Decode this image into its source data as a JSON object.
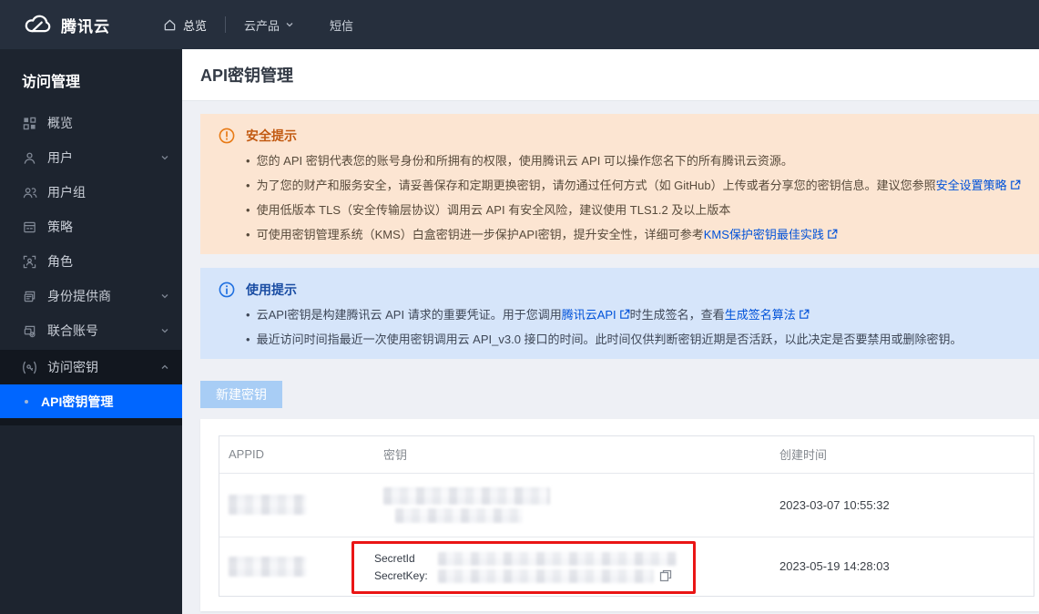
{
  "topbar": {
    "brand": "腾讯云",
    "overview": "总览",
    "cloud_products": "云产品",
    "sms": "短信"
  },
  "sidebar": {
    "title": "访问管理",
    "items": [
      {
        "label": "概览"
      },
      {
        "label": "用户",
        "expandable": true
      },
      {
        "label": "用户组"
      },
      {
        "label": "策略"
      },
      {
        "label": "角色"
      },
      {
        "label": "身份提供商",
        "expandable": true
      },
      {
        "label": "联合账号",
        "expandable": true
      },
      {
        "label": "访问密钥",
        "expandable": true,
        "expanded": true
      }
    ],
    "active_subitem": "API密钥管理"
  },
  "page": {
    "title": "API密钥管理"
  },
  "alerts": {
    "security": {
      "title": "安全提示",
      "bullets": [
        {
          "text": "您的 API 密钥代表您的账号身份和所拥有的权限，使用腾讯云 API 可以操作您名下的所有腾讯云资源。"
        },
        {
          "text": "为了您的财产和服务安全，请妥善保存和定期更换密钥，请勿通过任何方式（如 GitHub）上传或者分享您的密钥信息。建议您参照",
          "link": "安全设置策略"
        },
        {
          "text": "使用低版本 TLS（安全传输层协议）调用云 API 有安全风险，建议使用 TLS1.2 及以上版本"
        },
        {
          "text": "可使用密钥管理系统（KMS）白盒密钥进一步保护API密钥，提升安全性，详细可参考",
          "link": "KMS保护密钥最佳实践"
        }
      ]
    },
    "usage": {
      "title": "使用提示",
      "bullets": [
        {
          "pre": "云API密钥是构建腾讯云 API 请求的重要凭证。用于您调用",
          "link_cloud_api": "腾讯云API",
          "mid": "时生成签名，查看",
          "link_sign_algo": "生成签名算法"
        },
        {
          "text": "最近访问时间指最近一次使用密钥调用云 API_v3.0 接口的时间。此时间仅供判断密钥近期是否活跃，以此决定是否要禁用或删除密钥。"
        }
      ]
    }
  },
  "actions": {
    "create_key": "新建密钥"
  },
  "table": {
    "columns": [
      "APPID",
      "密钥",
      "创建时间"
    ],
    "rows": [
      {
        "appid_masked": true,
        "key_masked": true,
        "created": "2023-03-07 10:55:32"
      },
      {
        "appid_masked": true,
        "secret_id_label": "SecretId",
        "secret_key_label": "SecretKey:",
        "created": "2023-05-19 14:28:03",
        "highlighted": true
      }
    ]
  },
  "colors": {
    "topbar_bg": "#262f3d",
    "sidebar_bg": "#1d242f",
    "accent_blue": "#0066ff",
    "link_blue": "#0052d9",
    "warning_bg": "#fce5d2",
    "warning_orange": "#e87a15",
    "info_bg": "#d6e5fa",
    "info_blue": "#2070e0",
    "highlight_red": "#ea1515",
    "create_button_bg": "#a8cdf5"
  }
}
